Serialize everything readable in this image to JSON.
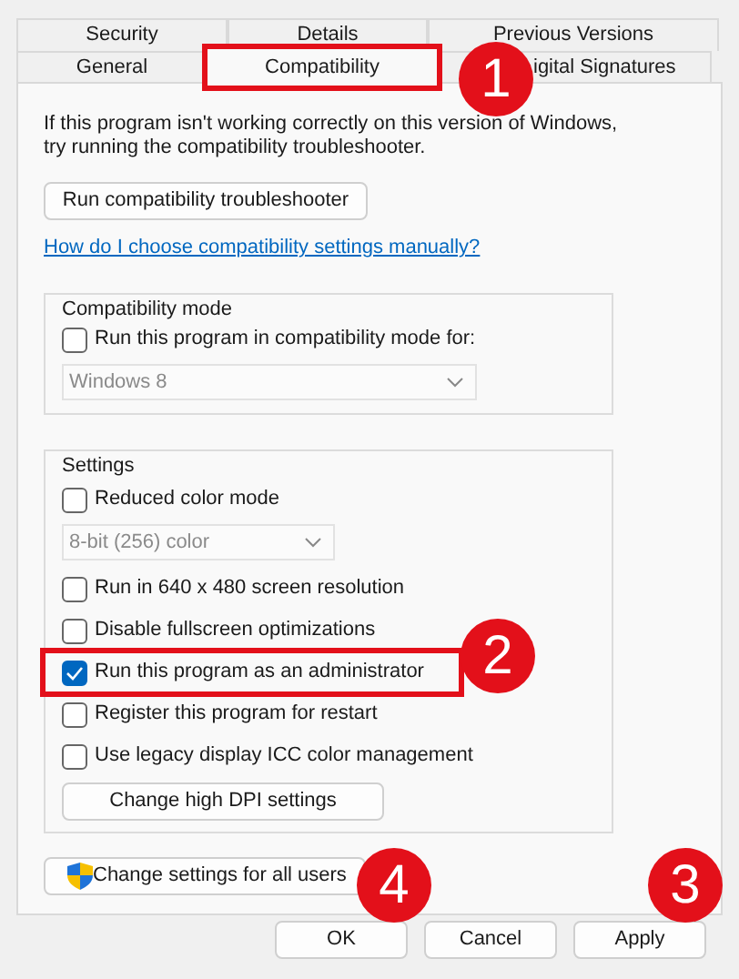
{
  "tab_rows": [
    [
      {
        "label": "Security",
        "selected": false,
        "highlighted": false
      },
      {
        "label": "Details",
        "selected": false,
        "highlighted": false
      },
      {
        "label": "Previous Versions",
        "selected": false,
        "highlighted": false
      }
    ],
    [
      {
        "label": "General",
        "selected": false,
        "highlighted": false
      },
      {
        "label": "Compatibility",
        "selected": true,
        "highlighted": true
      },
      {
        "label": "igital Signatures",
        "selected": false,
        "highlighted": false
      }
    ]
  ],
  "intro": [
    "If this program isn't working correctly on this version of Windows,",
    "try running the compatibility troubleshooter."
  ],
  "troubleshooter_button": "Run compatibility troubleshooter",
  "help_link": "How do I choose compatibility settings manually?",
  "compatibility_mode": {
    "title": "Compatibility mode",
    "items": [
      {
        "kind": "checkbox",
        "label": "Run this program in compatibility mode for:",
        "checked": false,
        "highlighted": false
      },
      {
        "kind": "dropdown",
        "value": "Windows 8",
        "disabled": true
      }
    ]
  },
  "settings": {
    "title": "Settings",
    "items": [
      {
        "kind": "checkbox",
        "label": "Reduced color mode",
        "checked": false,
        "highlighted": false
      },
      {
        "kind": "dropdown",
        "value": "8-bit (256) color",
        "disabled": true
      },
      {
        "kind": "checkbox",
        "label": "Run in 640 x 480 screen resolution",
        "checked": false,
        "highlighted": false
      },
      {
        "kind": "checkbox",
        "label": "Disable fullscreen optimizations",
        "checked": false,
        "highlighted": false
      },
      {
        "kind": "checkbox",
        "label": "Run this program as an administrator",
        "checked": true,
        "highlighted": true
      },
      {
        "kind": "checkbox",
        "label": "Register this program for restart",
        "checked": false,
        "highlighted": false
      },
      {
        "kind": "checkbox",
        "label": "Use legacy display ICC color management",
        "checked": false,
        "highlighted": false
      },
      {
        "kind": "button",
        "label": "Change high DPI settings"
      }
    ]
  },
  "all_users_button": "Change settings for all users",
  "buttons": [
    "OK",
    "Cancel",
    "Apply"
  ],
  "annotations": [
    "1",
    "2",
    "3",
    "4"
  ]
}
